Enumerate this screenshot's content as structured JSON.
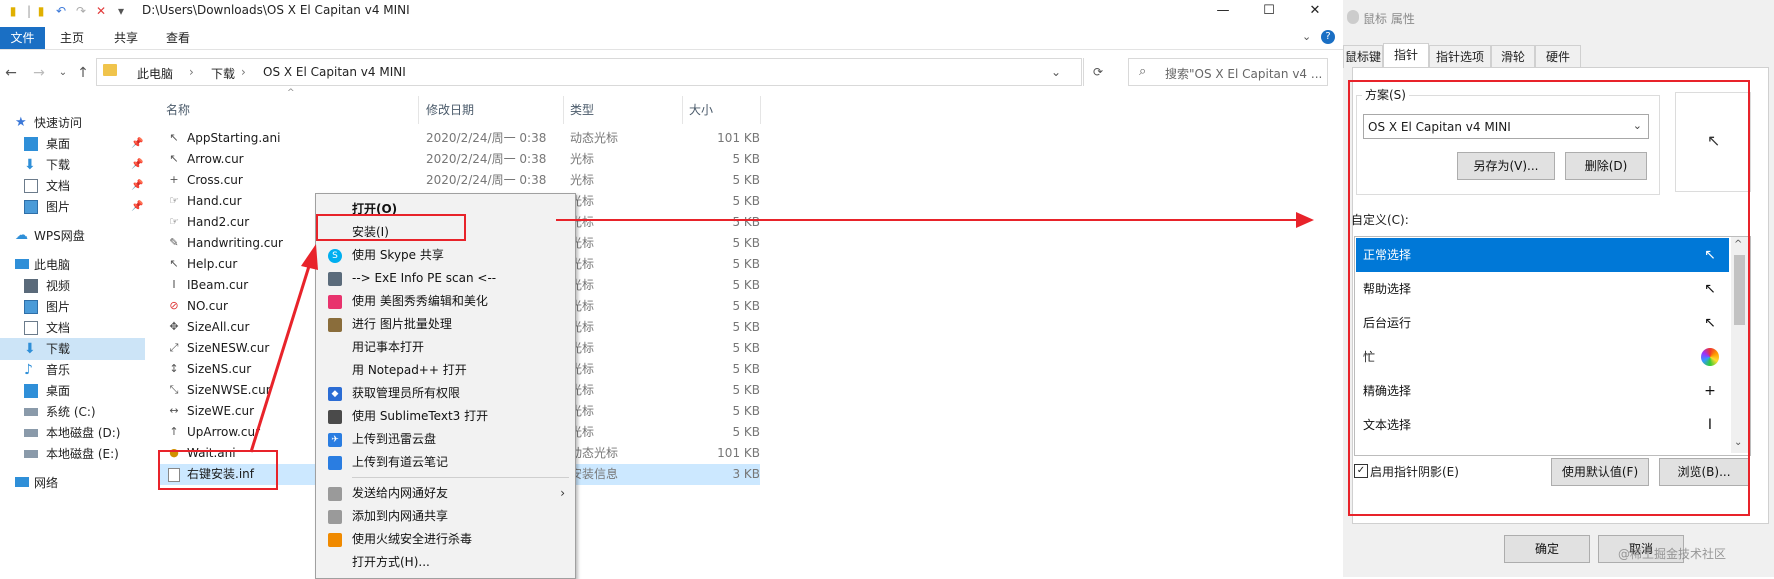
{
  "explorer": {
    "title": "D:\\Users\\Downloads\\OS X El Capitan v4 MINI",
    "window_controls": {
      "minimize": "—",
      "maximize": "☐",
      "close": "✕"
    },
    "ribbon_tabs": [
      "文件",
      "主页",
      "共享",
      "查看"
    ],
    "breadcrumb": [
      "此电脑",
      "下载",
      "OS X El Capitan v4 MINI"
    ],
    "search_placeholder": "搜索\"OS X El Capitan v4 ...",
    "sidebar": [
      {
        "label": "快速访问",
        "icon": "star-icon",
        "pin": false
      },
      {
        "label": "桌面",
        "icon": "desktop-icon",
        "pin": true
      },
      {
        "label": "下载",
        "icon": "download-icon",
        "pin": true
      },
      {
        "label": "文档",
        "icon": "document-icon",
        "pin": true
      },
      {
        "label": "图片",
        "icon": "picture-icon",
        "pin": true
      },
      {
        "label": "WPS网盘",
        "icon": "cloud-icon",
        "pin": false
      },
      {
        "label": "此电脑",
        "icon": "computer-icon",
        "pin": false
      },
      {
        "label": "视频",
        "icon": "video-icon",
        "pin": false
      },
      {
        "label": "图片",
        "icon": "picture-icon",
        "pin": false
      },
      {
        "label": "文档",
        "icon": "document-icon",
        "pin": false
      },
      {
        "label": "下载",
        "icon": "download-icon",
        "pin": false
      },
      {
        "label": "音乐",
        "icon": "music-icon",
        "pin": false
      },
      {
        "label": "桌面",
        "icon": "desktop-icon",
        "pin": false
      },
      {
        "label": "系统 (C:)",
        "icon": "drive-icon",
        "pin": false
      },
      {
        "label": "本地磁盘 (D:)",
        "icon": "drive-icon",
        "pin": false
      },
      {
        "label": "本地磁盘 (E:)",
        "icon": "drive-icon",
        "pin": false
      },
      {
        "label": "网络",
        "icon": "network-icon",
        "pin": false
      }
    ],
    "columns": {
      "name": "名称",
      "date": "修改日期",
      "type": "类型",
      "size": "大小"
    },
    "files": [
      {
        "name": "AppStarting.ani",
        "date": "2020/2/24/周一 0:38",
        "type": "动态光标",
        "size": "101 KB",
        "icon": "cursor-busy-icon"
      },
      {
        "name": "Arrow.cur",
        "date": "2020/2/24/周一 0:38",
        "type": "光标",
        "size": "5 KB",
        "icon": "cursor-arrow-icon"
      },
      {
        "name": "Cross.cur",
        "date": "2020/2/24/周一 0:38",
        "type": "光标",
        "size": "5 KB",
        "icon": "cursor-cross-icon"
      },
      {
        "name": "Hand.cur",
        "date": "",
        "type": "光标",
        "size": "5 KB",
        "icon": "cursor-hand-icon"
      },
      {
        "name": "Hand2.cur",
        "date": "",
        "type": "光标",
        "size": "5 KB",
        "icon": "cursor-hand-icon"
      },
      {
        "name": "Handwriting.cur",
        "date": "",
        "type": "光标",
        "size": "5 KB",
        "icon": "cursor-pen-icon"
      },
      {
        "name": "Help.cur",
        "date": "",
        "type": "光标",
        "size": "5 KB",
        "icon": "cursor-help-icon"
      },
      {
        "name": "IBeam.cur",
        "date": "",
        "type": "光标",
        "size": "5 KB",
        "icon": "cursor-ibeam-icon"
      },
      {
        "name": "NO.cur",
        "date": "",
        "type": "光标",
        "size": "5 KB",
        "icon": "cursor-no-icon"
      },
      {
        "name": "SizeAll.cur",
        "date": "",
        "type": "光标",
        "size": "5 KB",
        "icon": "cursor-move-icon"
      },
      {
        "name": "SizeNESW.cur",
        "date": "",
        "type": "光标",
        "size": "5 KB",
        "icon": "cursor-resize-icon"
      },
      {
        "name": "SizeNS.cur",
        "date": "",
        "type": "光标",
        "size": "5 KB",
        "icon": "cursor-resize-icon"
      },
      {
        "name": "SizeNWSE.cur",
        "date": "",
        "type": "光标",
        "size": "5 KB",
        "icon": "cursor-resize-icon"
      },
      {
        "name": "SizeWE.cur",
        "date": "",
        "type": "光标",
        "size": "5 KB",
        "icon": "cursor-resize-icon"
      },
      {
        "name": "UpArrow.cur",
        "date": "",
        "type": "光标",
        "size": "5 KB",
        "icon": "cursor-uparrow-icon"
      },
      {
        "name": "Wait.ani",
        "date": "",
        "type": "动态光标",
        "size": "101 KB",
        "icon": "cursor-wait-icon"
      },
      {
        "name": "右键安装.inf",
        "date": "",
        "type": "安装信息",
        "size": "3 KB",
        "icon": "inf-file-icon"
      }
    ]
  },
  "context_menu": [
    {
      "label": "打开(O)",
      "icon": "",
      "bold": true
    },
    {
      "label": "安装(I)",
      "icon": ""
    },
    {
      "label": "使用 Skype 共享",
      "icon": "skype-icon",
      "color": "#00aff0"
    },
    {
      "label": "--> ExE Info PE scan <--",
      "icon": "exeinfo-icon",
      "color": "#5b6b7b"
    },
    {
      "label": "使用 美图秀秀编辑和美化",
      "icon": "meitu-icon",
      "color": "#e8336d"
    },
    {
      "label": "进行 图片批量处理",
      "icon": "batch-image-icon",
      "color": "#8a6d3b"
    },
    {
      "label": "用记事本打开",
      "icon": ""
    },
    {
      "label": "用 Notepad++ 打开",
      "icon": ""
    },
    {
      "label": "获取管理员所有权限",
      "icon": "shield-icon",
      "color": "#2b6cd4"
    },
    {
      "label": "使用 SublimeText3 打开",
      "icon": "sublime-icon",
      "color": "#4a4a4a"
    },
    {
      "label": "上传到迅雷云盘",
      "icon": "xunlei-icon",
      "color": "#2a7de1"
    },
    {
      "label": "上传到有道云笔记",
      "icon": "youdao-icon",
      "color": "#2a7de1"
    },
    {
      "label": "发送给内网通好友",
      "icon": "neiwangtong-icon",
      "color": "#9a9a9a",
      "submenu": true
    },
    {
      "label": "添加到内网通共享",
      "icon": "neiwangtong-icon",
      "color": "#9a9a9a"
    },
    {
      "label": "使用火绒安全进行杀毒",
      "icon": "huorong-icon",
      "color": "#f08a00"
    },
    {
      "label": "打开方式(H)...",
      "icon": ""
    }
  ],
  "dialog": {
    "title": "鼠标 属性",
    "tabs": [
      "鼠标键",
      "指针",
      "指针选项",
      "滑轮",
      "硬件"
    ],
    "scheme_label": "方案(S)",
    "scheme_value": "OS X El Capitan v4 MINI",
    "save_as": "另存为(V)...",
    "delete": "删除(D)",
    "customize_label": "自定义(C):",
    "cursors": [
      {
        "label": "正常选择",
        "icon": "cursor-arrow-icon"
      },
      {
        "label": "帮助选择",
        "icon": "cursor-help-icon"
      },
      {
        "label": "后台运行",
        "icon": "cursor-busy-icon"
      },
      {
        "label": "忙",
        "icon": "cursor-wait-icon"
      },
      {
        "label": "精确选择",
        "icon": "cursor-cross-icon"
      },
      {
        "label": "文本选择",
        "icon": "cursor-ibeam-icon"
      }
    ],
    "shadow_label": "启用指针阴影(E)",
    "use_default": "使用默认值(F)",
    "browse": "浏览(B)...",
    "ok": "确定",
    "cancel": "取消",
    "watermark": "@稀土掘金技术社区"
  },
  "colors": {
    "accent": "#0078d7",
    "annotation": "#e8232a",
    "ribbon_file": "#1a6fc4"
  }
}
